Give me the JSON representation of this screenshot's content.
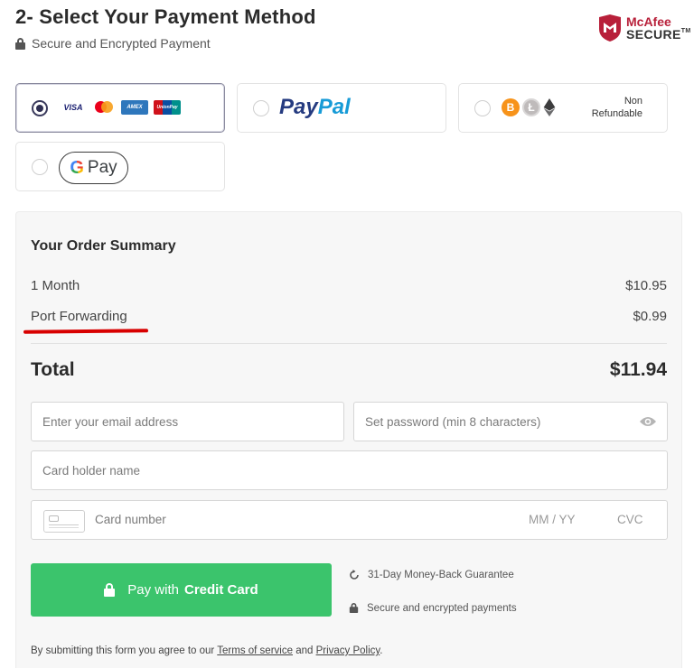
{
  "header": {
    "title": "2- Select Your Payment Method",
    "secure_text": "Secure and Encrypted Payment",
    "badge_brand": "McAfee",
    "badge_secure": "SECURE",
    "badge_tm": "TM"
  },
  "payment_options": {
    "cards": {
      "selected": true,
      "logos": [
        "VISA",
        "mastercard",
        "AMEX",
        "UnionPay"
      ]
    },
    "paypal": {
      "label_part1": "Pay",
      "label_part2": "Pal",
      "selected": false
    },
    "crypto": {
      "coins": [
        "bitcoin",
        "litecoin",
        "ethereum"
      ],
      "note_line1": "Non",
      "note_line2": "Refundable",
      "selected": false
    },
    "gpay": {
      "g": "G",
      "label": "Pay",
      "selected": false
    }
  },
  "order_summary": {
    "title": "Your Order Summary",
    "items": [
      {
        "label": "1 Month",
        "price": "$10.95"
      },
      {
        "label": "Port Forwarding",
        "price": "$0.99"
      }
    ],
    "total_label": "Total",
    "total_value": "$11.94"
  },
  "form": {
    "email_placeholder": "Enter your email address",
    "password_placeholder": "Set password (min 8 characters)",
    "holder_placeholder": "Card holder name",
    "card_number_placeholder": "Card number",
    "expiry_placeholder": "MM / YY",
    "cvc_placeholder": "CVC"
  },
  "actions": {
    "pay_prefix": "Pay with",
    "pay_bold": "Credit Card"
  },
  "assurances": {
    "guarantee": "31-Day Money-Back Guarantee",
    "secure_payments": "Secure and encrypted payments"
  },
  "legal": {
    "prefix": "By submitting this form you agree to our",
    "terms": "Terms of service",
    "and": "and",
    "privacy": "Privacy Policy",
    "suffix": "."
  },
  "colors": {
    "accent_green": "#3bc46c",
    "highlight_red": "#d80000",
    "paypal_dark": "#253b80",
    "paypal_light": "#179bd7"
  }
}
